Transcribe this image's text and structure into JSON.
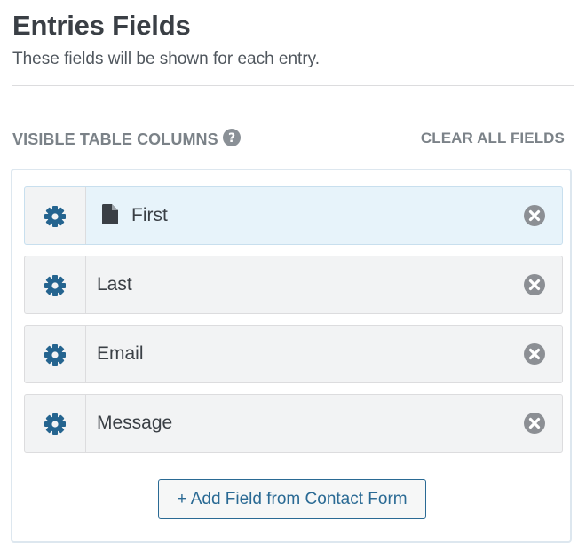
{
  "header": {
    "title": "Entries Fields",
    "subtitle": "These fields will be shown for each entry."
  },
  "columns": {
    "title": "VISIBLE TABLE COLUMNS",
    "help_icon": "question-circle-icon",
    "clear_all_label": "CLEAR ALL FIELDS"
  },
  "fields": [
    {
      "label": "First",
      "active": true,
      "icon": "file-icon"
    },
    {
      "label": "Last",
      "active": false,
      "icon": ""
    },
    {
      "label": "Email",
      "active": false,
      "icon": ""
    },
    {
      "label": "Message",
      "active": false,
      "icon": ""
    }
  ],
  "add_field_label": "+ Add Field from Contact Form",
  "colors": {
    "accent": "#2a6a94",
    "gear": "#25648f",
    "remove": "#8c8f94",
    "active_row": "#e7f3fa"
  }
}
